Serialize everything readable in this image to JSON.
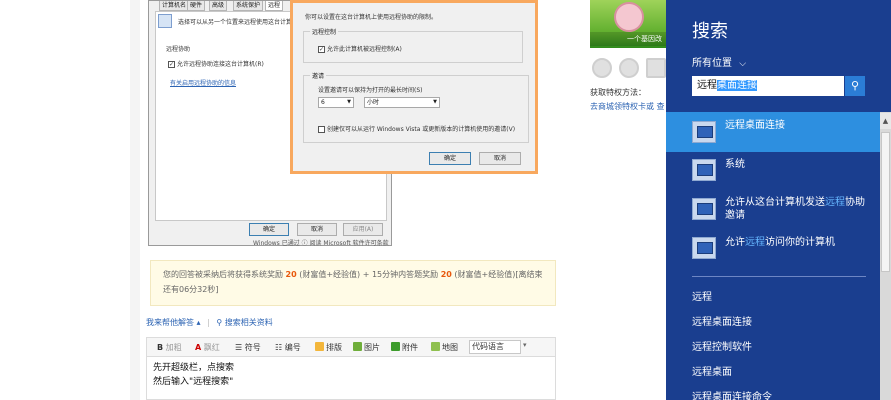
{
  "back_dialog": {
    "tabs": [
      "计算机名",
      "硬件",
      "高级",
      "系统保护",
      "远程"
    ],
    "desc": "选择可以从另一个位置来远程使用这台计算机的",
    "group_title": "远程协助",
    "checkbox_label": "允许远程协助连接这台计算机(R)",
    "link": "有关启用远程协助的信息",
    "buttons": {
      "ok": "确定",
      "cancel": "取消",
      "apply": "应用(A)"
    },
    "footer_text": "Windows 已通过 ⓘ 阅读 Microsoft 软件许可条款"
  },
  "front_dialog": {
    "desc": "你可以设置在这台计算机上使用远程协助的限制。",
    "remote_group": "远程控制",
    "remote_checkbox": "允许此计算机被远程控制(A)",
    "invite_group": "邀请",
    "invite_label": "设置邀请可以保持为打开的最长时间(S)",
    "time_value": "6",
    "unit_value": "小时",
    "vista_checkbox": "创建仅可以从运行 Windows Vista 或更新版本的计算机使用的邀请(V)",
    "ok": "确定",
    "cancel": "取消"
  },
  "promo": {
    "line1_pre": "您的回答被采纳后将获得系统奖励",
    "r1": "20",
    "line1_mid": "(财富值+经验值) + 15分钟内答题奖励",
    "r2": "20",
    "line1_post": "(财富值+经验值)[离结束",
    "line2": "还有06分32秒]"
  },
  "help": {
    "link1": "我来帮他解答",
    "link2": "搜索相关资料"
  },
  "toolbar": {
    "bold": "加粗",
    "cutout": "飘红",
    "symbol": "符号",
    "number": "编号",
    "format": "排版",
    "image": "图片",
    "attach": "附件",
    "map": "地图",
    "code": "代码语言"
  },
  "editor": {
    "line1": "先开超级栏，点搜索",
    "line2": "然后输入\"远程搜索\""
  },
  "right_col": {
    "caption": "一个基因改",
    "privilege_label": "获取特权方法：",
    "privilege_link": "去商城领特权卡或 查"
  },
  "charm": {
    "title": "搜索",
    "scope": "所有位置",
    "query_pre": "远程",
    "query_sel": "桌面连接",
    "results": [
      {
        "pre": "远程",
        "hl": "",
        "post": "桌面连接",
        "line2": ""
      },
      {
        "pre": "系统",
        "hl": "",
        "post": "",
        "line2": ""
      },
      {
        "pre": "允许从这台计算机发送",
        "hl": "远程",
        "post": "协助",
        "line2": "邀请"
      },
      {
        "pre": "允许",
        "hl": "远程",
        "post": "访问你的计算机",
        "line2": ""
      }
    ],
    "suggestions": [
      "远程",
      "远程桌面连接",
      "远程控制软件",
      "远程桌面",
      "远程桌面连接命令"
    ]
  },
  "colors": {
    "charm_bg": "#1a3e8f",
    "active_result": "#2d8fe0",
    "dialog_border": "#f8a85e",
    "reward": "#e8580c",
    "link": "#2d64b3"
  }
}
